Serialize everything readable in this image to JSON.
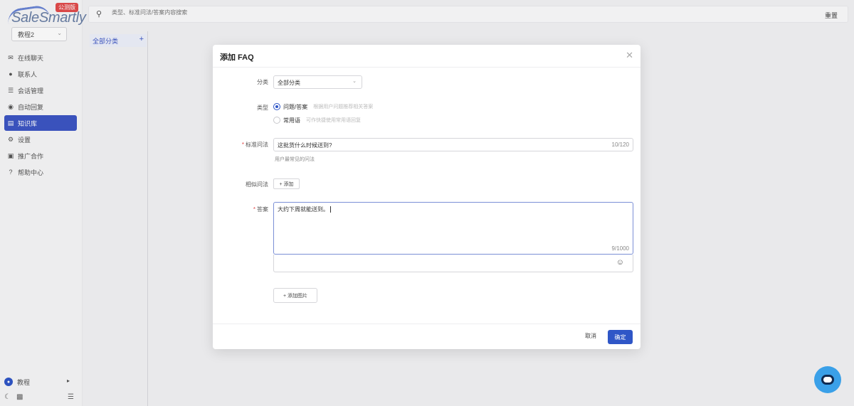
{
  "app": {
    "brand": "SaleSmartly",
    "edition_badge": "公测版",
    "team_selector": "教程2"
  },
  "nav": {
    "items": [
      {
        "label": "在线聊天",
        "icon": "chat-icon"
      },
      {
        "label": "联系人",
        "icon": "contacts-icon"
      },
      {
        "label": "会话管理",
        "icon": "database-icon"
      },
      {
        "label": "自动回复",
        "icon": "robot-icon"
      },
      {
        "label": "知识库",
        "icon": "book-icon",
        "active": true
      },
      {
        "label": "设置",
        "icon": "gear-icon"
      },
      {
        "label": "推广合作",
        "icon": "share-icon"
      },
      {
        "label": "帮助中心",
        "icon": "help-icon"
      }
    ],
    "bottom_user": "教程"
  },
  "search": {
    "placeholder": "类型、标准问法/答案内容搜索",
    "reset_label": "重置"
  },
  "categories": {
    "all_label": "全部分类",
    "add_symbol": "+"
  },
  "modal": {
    "title": "添加 FAQ",
    "category": {
      "label": "分类",
      "value": "全部分类"
    },
    "type": {
      "label": "类型",
      "option_qa": "问题/答案",
      "option_qa_hint": "根据用户问题推荐相关答案",
      "option_phrase": "常用语",
      "option_phrase_hint": "可作快捷使用常用语回复"
    },
    "standard_question": {
      "label": "标准问法",
      "value": "这批货什么时候送到?",
      "count": "10/120",
      "hint": "用户最常见的问法"
    },
    "similar_question": {
      "label": "相似问法",
      "add_label": "+  添加"
    },
    "answer": {
      "label": "答案",
      "value": "大约下周就能送到。",
      "count": "9/1000"
    },
    "add_image_label": "+  添加图片",
    "cancel_label": "取消",
    "ok_label": "确定"
  },
  "colors": {
    "primary": "#2f56c7",
    "required": "#e24b4b",
    "chat_bubble": "#3aa0e8"
  }
}
